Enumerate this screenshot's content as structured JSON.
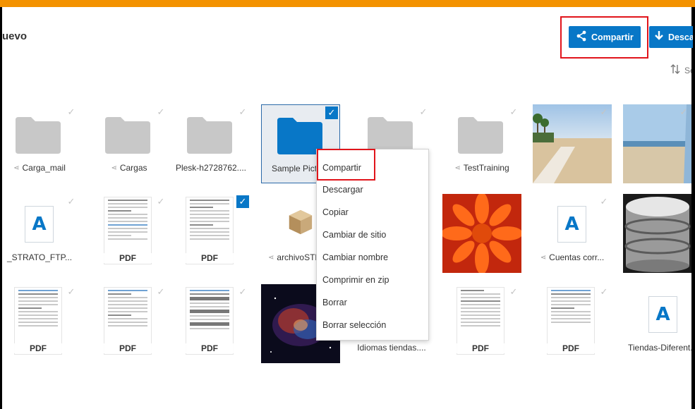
{
  "header": {
    "title_partial": "uevo",
    "share_label": "Compartir",
    "download_label": "Descar",
    "sort_label": "Se"
  },
  "icons": {
    "share": "share-icon",
    "download": "download-icon",
    "sort": "sort-icon",
    "check": "checkmark-icon",
    "folder": "folder-icon",
    "package": "package-icon",
    "database": "database-icon"
  },
  "colors": {
    "accent": "#0877c7",
    "top_bar": "#f39200",
    "highlight": "#e1141b",
    "folder_gray": "#c8c8c8",
    "folder_blue": "#0877c7"
  },
  "files": {
    "row1": [
      {
        "name": "Carga_mail",
        "shared": true
      },
      {
        "name": "Cargas",
        "shared": true
      },
      {
        "name": "Plesk-h2728762....",
        "shared": false
      },
      {
        "name": "Sample Pictu",
        "shared": false,
        "selected": true
      },
      {
        "name": "",
        "shared": false
      },
      {
        "name": "TestTraining",
        "shared": true
      },
      {
        "name": "",
        "shared": false
      },
      {
        "name": "",
        "shared": false
      }
    ],
    "row2": [
      {
        "name": "_STRATO_FTP...",
        "shared": false
      },
      {
        "name": "",
        "type_tag": "PDF"
      },
      {
        "name": "",
        "type_tag": "PDF",
        "selected": true
      },
      {
        "name": "archivoSTR",
        "shared": true
      },
      {
        "name": ""
      },
      {
        "name": "Cuentas corr...",
        "shared": true
      },
      {
        "name": ""
      }
    ],
    "row3": [
      {
        "name": "",
        "type_tag": "PDF"
      },
      {
        "name": "",
        "type_tag": "PDF"
      },
      {
        "name": "",
        "type_tag": "PDF"
      },
      {
        "name": ""
      },
      {
        "name": "Idiomas tiendas...."
      },
      {
        "name": "",
        "type_tag": "PDF"
      },
      {
        "name": "",
        "type_tag": "PDF"
      },
      {
        "name": "Tiendas-Diferent..."
      }
    ],
    "doc_letter": "A"
  },
  "context_menu": {
    "items": [
      "Compartir",
      "Descargar",
      "Copiar",
      "Cambiar de sitio",
      "Cambiar nombre",
      "Comprimir en zip",
      "Borrar",
      "Borrar selección"
    ]
  }
}
